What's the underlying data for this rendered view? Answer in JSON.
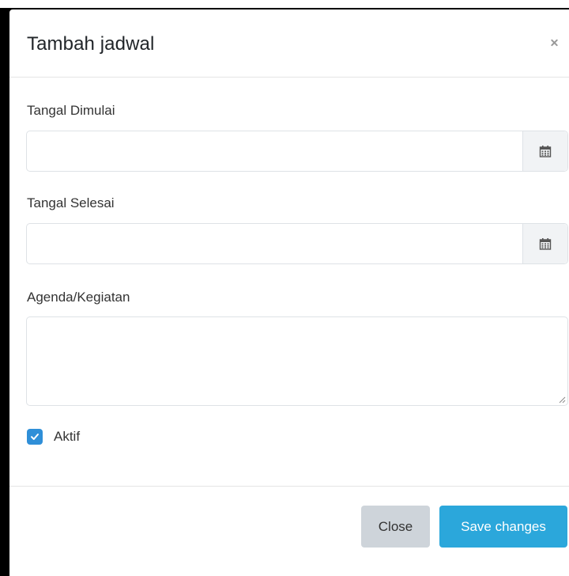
{
  "modal": {
    "title": "Tambah jadwal",
    "close_icon": "close-icon"
  },
  "fields": {
    "start_date": {
      "label": "Tangal Dimulai",
      "value": "",
      "icon": "calendar-icon"
    },
    "end_date": {
      "label": "Tangal Selesai",
      "value": "",
      "icon": "calendar-icon"
    },
    "agenda": {
      "label": "Agenda/Kegiatan",
      "value": ""
    }
  },
  "active": {
    "label": "Aktif",
    "checked": true
  },
  "footer": {
    "close_label": "Close",
    "save_label": "Save changes"
  },
  "colors": {
    "primary": "#2ba7db",
    "checkbox": "#2f8fd8",
    "secondary": "#ced4da"
  }
}
